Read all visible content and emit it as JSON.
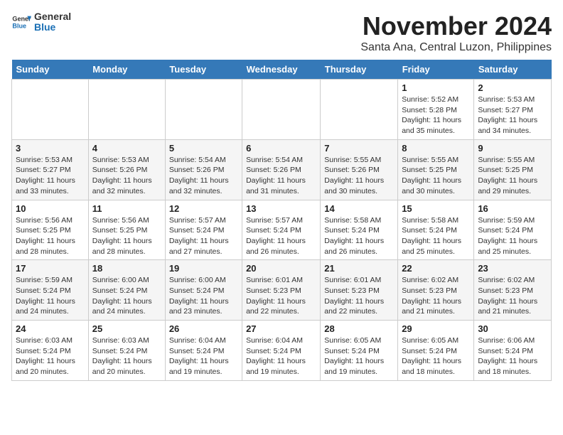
{
  "app": {
    "logo_general": "General",
    "logo_blue": "Blue",
    "month_title": "November 2024",
    "subtitle": "Santa Ana, Central Luzon, Philippines"
  },
  "days_of_week": [
    "Sunday",
    "Monday",
    "Tuesday",
    "Wednesday",
    "Thursday",
    "Friday",
    "Saturday"
  ],
  "weeks": [
    [
      {
        "day": "",
        "info": ""
      },
      {
        "day": "",
        "info": ""
      },
      {
        "day": "",
        "info": ""
      },
      {
        "day": "",
        "info": ""
      },
      {
        "day": "",
        "info": ""
      },
      {
        "day": "1",
        "info": "Sunrise: 5:52 AM\nSunset: 5:28 PM\nDaylight: 11 hours\nand 35 minutes."
      },
      {
        "day": "2",
        "info": "Sunrise: 5:53 AM\nSunset: 5:27 PM\nDaylight: 11 hours\nand 34 minutes."
      }
    ],
    [
      {
        "day": "3",
        "info": "Sunrise: 5:53 AM\nSunset: 5:27 PM\nDaylight: 11 hours\nand 33 minutes."
      },
      {
        "day": "4",
        "info": "Sunrise: 5:53 AM\nSunset: 5:26 PM\nDaylight: 11 hours\nand 32 minutes."
      },
      {
        "day": "5",
        "info": "Sunrise: 5:54 AM\nSunset: 5:26 PM\nDaylight: 11 hours\nand 32 minutes."
      },
      {
        "day": "6",
        "info": "Sunrise: 5:54 AM\nSunset: 5:26 PM\nDaylight: 11 hours\nand 31 minutes."
      },
      {
        "day": "7",
        "info": "Sunrise: 5:55 AM\nSunset: 5:26 PM\nDaylight: 11 hours\nand 30 minutes."
      },
      {
        "day": "8",
        "info": "Sunrise: 5:55 AM\nSunset: 5:25 PM\nDaylight: 11 hours\nand 30 minutes."
      },
      {
        "day": "9",
        "info": "Sunrise: 5:55 AM\nSunset: 5:25 PM\nDaylight: 11 hours\nand 29 minutes."
      }
    ],
    [
      {
        "day": "10",
        "info": "Sunrise: 5:56 AM\nSunset: 5:25 PM\nDaylight: 11 hours\nand 28 minutes."
      },
      {
        "day": "11",
        "info": "Sunrise: 5:56 AM\nSunset: 5:25 PM\nDaylight: 11 hours\nand 28 minutes."
      },
      {
        "day": "12",
        "info": "Sunrise: 5:57 AM\nSunset: 5:24 PM\nDaylight: 11 hours\nand 27 minutes."
      },
      {
        "day": "13",
        "info": "Sunrise: 5:57 AM\nSunset: 5:24 PM\nDaylight: 11 hours\nand 26 minutes."
      },
      {
        "day": "14",
        "info": "Sunrise: 5:58 AM\nSunset: 5:24 PM\nDaylight: 11 hours\nand 26 minutes."
      },
      {
        "day": "15",
        "info": "Sunrise: 5:58 AM\nSunset: 5:24 PM\nDaylight: 11 hours\nand 25 minutes."
      },
      {
        "day": "16",
        "info": "Sunrise: 5:59 AM\nSunset: 5:24 PM\nDaylight: 11 hours\nand 25 minutes."
      }
    ],
    [
      {
        "day": "17",
        "info": "Sunrise: 5:59 AM\nSunset: 5:24 PM\nDaylight: 11 hours\nand 24 minutes."
      },
      {
        "day": "18",
        "info": "Sunrise: 6:00 AM\nSunset: 5:24 PM\nDaylight: 11 hours\nand 24 minutes."
      },
      {
        "day": "19",
        "info": "Sunrise: 6:00 AM\nSunset: 5:24 PM\nDaylight: 11 hours\nand 23 minutes."
      },
      {
        "day": "20",
        "info": "Sunrise: 6:01 AM\nSunset: 5:23 PM\nDaylight: 11 hours\nand 22 minutes."
      },
      {
        "day": "21",
        "info": "Sunrise: 6:01 AM\nSunset: 5:23 PM\nDaylight: 11 hours\nand 22 minutes."
      },
      {
        "day": "22",
        "info": "Sunrise: 6:02 AM\nSunset: 5:23 PM\nDaylight: 11 hours\nand 21 minutes."
      },
      {
        "day": "23",
        "info": "Sunrise: 6:02 AM\nSunset: 5:23 PM\nDaylight: 11 hours\nand 21 minutes."
      }
    ],
    [
      {
        "day": "24",
        "info": "Sunrise: 6:03 AM\nSunset: 5:24 PM\nDaylight: 11 hours\nand 20 minutes."
      },
      {
        "day": "25",
        "info": "Sunrise: 6:03 AM\nSunset: 5:24 PM\nDaylight: 11 hours\nand 20 minutes."
      },
      {
        "day": "26",
        "info": "Sunrise: 6:04 AM\nSunset: 5:24 PM\nDaylight: 11 hours\nand 19 minutes."
      },
      {
        "day": "27",
        "info": "Sunrise: 6:04 AM\nSunset: 5:24 PM\nDaylight: 11 hours\nand 19 minutes."
      },
      {
        "day": "28",
        "info": "Sunrise: 6:05 AM\nSunset: 5:24 PM\nDaylight: 11 hours\nand 19 minutes."
      },
      {
        "day": "29",
        "info": "Sunrise: 6:05 AM\nSunset: 5:24 PM\nDaylight: 11 hours\nand 18 minutes."
      },
      {
        "day": "30",
        "info": "Sunrise: 6:06 AM\nSunset: 5:24 PM\nDaylight: 11 hours\nand 18 minutes."
      }
    ]
  ]
}
